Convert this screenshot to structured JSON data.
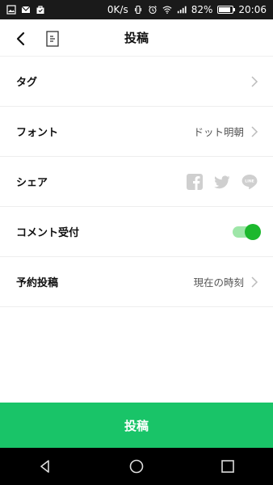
{
  "status_bar": {
    "net_speed": "0K/s",
    "battery": "82%",
    "battery_level": 0.82,
    "time": "20:06",
    "icons": [
      "image-icon",
      "mail-icon",
      "bag-icon",
      "vibrate-icon",
      "alarm-icon",
      "wifi-icon",
      "signal-icon",
      "battery-icon"
    ]
  },
  "header": {
    "title": "投稿",
    "icons": [
      "back-arrow-icon",
      "document-icon"
    ]
  },
  "settings": {
    "tag_label": "タグ",
    "font_label": "フォント",
    "font_value": "ドット明朝",
    "share_label": "シェア",
    "share_icons": [
      "facebook-icon",
      "twitter-icon",
      "line-icon"
    ],
    "comment_label": "コメント受付",
    "comment_enabled": true,
    "schedule_label": "予約投稿",
    "schedule_value": "現在の時刻"
  },
  "footer": {
    "post_button": "投稿",
    "accent_color": "#19c468"
  },
  "nav_bar": {
    "icons": [
      "nav-back-icon",
      "nav-home-icon",
      "nav-recents-icon"
    ]
  }
}
